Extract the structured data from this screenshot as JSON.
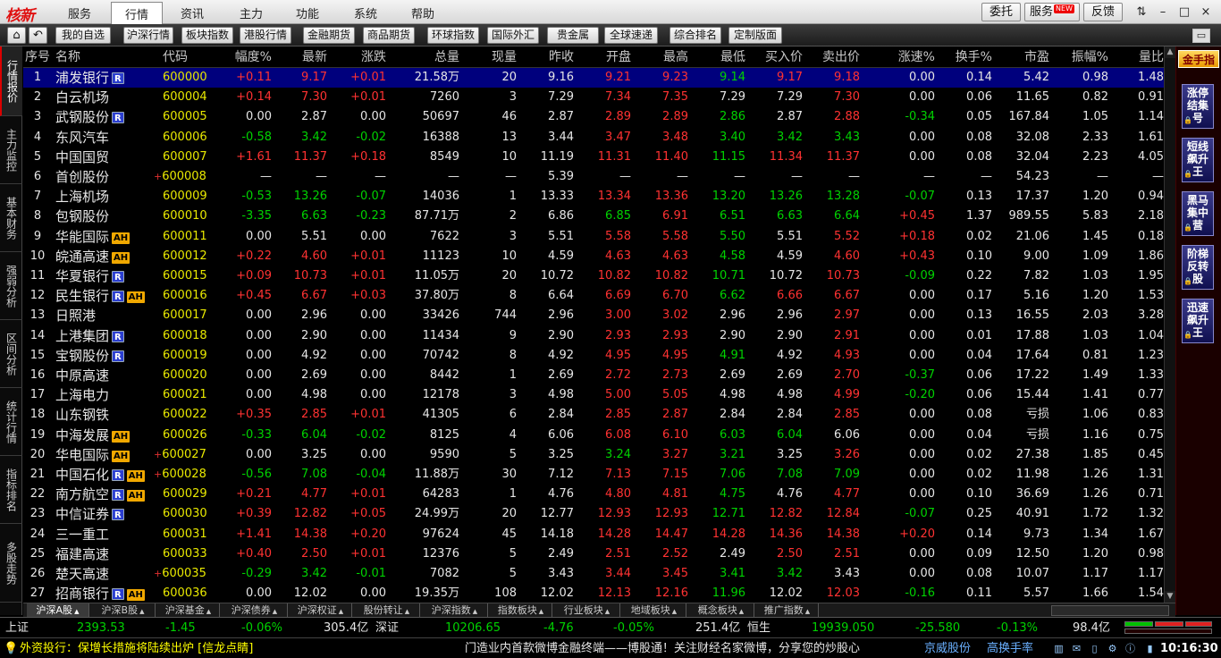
{
  "app": {
    "logo_text": "核新",
    "menu": [
      "服务",
      "行情",
      "资讯",
      "主力",
      "功能",
      "系统",
      "帮助"
    ],
    "active_menu": "行情",
    "right_buttons": {
      "weituo": "委托",
      "fuwu": "服务",
      "new_badge": "NEW",
      "fankui": "反馈"
    },
    "window_controls": [
      "⇅",
      "–",
      "□",
      "×"
    ]
  },
  "toolbar": {
    "buttons": [
      "我的自选",
      "沪深行情",
      "板块指数",
      "港股行情",
      "金融期货",
      "商品期货",
      "环球指数",
      "国际外汇",
      "贵金属",
      "全球速递",
      "综合排名",
      "定制版面"
    ]
  },
  "leftnav": [
    "行情报价",
    "主力监控",
    "基本财务",
    "强弱分析",
    "区间分析",
    "统计行情",
    "指标排名",
    "多股走势"
  ],
  "table": {
    "headers": [
      "序号",
      "名称",
      "代码",
      "幅度%",
      "最新",
      "涨跌",
      "总量",
      "现量",
      "昨收",
      "开盘",
      "最高",
      "最低",
      "买入价",
      "卖出价",
      "涨速%",
      "换手%",
      "市盈",
      "振幅%",
      "量比"
    ],
    "rows": [
      {
        "no": "1",
        "name": "浦发银行",
        "badges": [
          "R"
        ],
        "plus": false,
        "code": "600000",
        "chg_pct": "+0.11",
        "last": "9.17",
        "chg": "+0.01",
        "vol": "21.58万",
        "cur": "20",
        "prev": "9.16",
        "open": "9.21",
        "high": "9.23",
        "low": "9.14",
        "bid": "9.17",
        "ask": "9.18",
        "speed": "0.00",
        "turn": "0.14",
        "pe": "5.42",
        "amp": "0.98",
        "vr": "1.48"
      },
      {
        "no": "2",
        "name": "白云机场",
        "badges": [],
        "plus": false,
        "code": "600004",
        "chg_pct": "+0.14",
        "last": "7.30",
        "chg": "+0.01",
        "vol": "7260",
        "cur": "3",
        "prev": "7.29",
        "open": "7.34",
        "high": "7.35",
        "low": "7.29",
        "bid": "7.29",
        "ask": "7.30",
        "speed": "0.00",
        "turn": "0.06",
        "pe": "11.65",
        "amp": "0.82",
        "vr": "0.91"
      },
      {
        "no": "3",
        "name": "武钢股份",
        "badges": [
          "R"
        ],
        "plus": false,
        "code": "600005",
        "chg_pct": "0.00",
        "last": "2.87",
        "chg": "0.00",
        "vol": "50697",
        "cur": "46",
        "prev": "2.87",
        "open": "2.89",
        "high": "2.89",
        "low": "2.86",
        "bid": "2.87",
        "ask": "2.88",
        "speed": "-0.34",
        "turn": "0.05",
        "pe": "167.84",
        "amp": "1.05",
        "vr": "1.14"
      },
      {
        "no": "4",
        "name": "东风汽车",
        "badges": [],
        "plus": false,
        "code": "600006",
        "chg_pct": "-0.58",
        "last": "3.42",
        "chg": "-0.02",
        "vol": "16388",
        "cur": "13",
        "prev": "3.44",
        "open": "3.47",
        "high": "3.48",
        "low": "3.40",
        "bid": "3.42",
        "ask": "3.43",
        "speed": "0.00",
        "turn": "0.08",
        "pe": "32.08",
        "amp": "2.33",
        "vr": "1.61"
      },
      {
        "no": "5",
        "name": "中国国贸",
        "badges": [],
        "plus": false,
        "code": "600007",
        "chg_pct": "+1.61",
        "last": "11.37",
        "chg": "+0.18",
        "vol": "8549",
        "cur": "10",
        "prev": "11.19",
        "open": "11.31",
        "high": "11.40",
        "low": "11.15",
        "bid": "11.34",
        "ask": "11.37",
        "speed": "0.00",
        "turn": "0.08",
        "pe": "32.04",
        "amp": "2.23",
        "vr": "4.05"
      },
      {
        "no": "6",
        "name": "首创股份",
        "badges": [],
        "plus": true,
        "code": "600008",
        "chg_pct": "—",
        "last": "—",
        "chg": "—",
        "vol": "—",
        "cur": "—",
        "prev": "5.39",
        "open": "—",
        "high": "—",
        "low": "—",
        "bid": "—",
        "ask": "—",
        "speed": "—",
        "turn": "—",
        "pe": "54.23",
        "amp": "—",
        "vr": "—"
      },
      {
        "no": "7",
        "name": "上海机场",
        "badges": [],
        "plus": false,
        "code": "600009",
        "chg_pct": "-0.53",
        "last": "13.26",
        "chg": "-0.07",
        "vol": "14036",
        "cur": "1",
        "prev": "13.33",
        "open": "13.34",
        "high": "13.36",
        "low": "13.20",
        "bid": "13.26",
        "ask": "13.28",
        "speed": "-0.07",
        "turn": "0.13",
        "pe": "17.37",
        "amp": "1.20",
        "vr": "0.94"
      },
      {
        "no": "8",
        "name": "包钢股份",
        "badges": [],
        "plus": false,
        "code": "600010",
        "chg_pct": "-3.35",
        "last": "6.63",
        "chg": "-0.23",
        "vol": "87.71万",
        "cur": "2",
        "prev": "6.86",
        "open": "6.85",
        "high": "6.91",
        "low": "6.51",
        "bid": "6.63",
        "ask": "6.64",
        "speed": "+0.45",
        "turn": "1.37",
        "pe": "989.55",
        "amp": "5.83",
        "vr": "2.18"
      },
      {
        "no": "9",
        "name": "华能国际",
        "badges": [
          "AH"
        ],
        "plus": false,
        "code": "600011",
        "chg_pct": "0.00",
        "last": "5.51",
        "chg": "0.00",
        "vol": "7622",
        "cur": "3",
        "prev": "5.51",
        "open": "5.58",
        "high": "5.58",
        "low": "5.50",
        "bid": "5.51",
        "ask": "5.52",
        "speed": "+0.18",
        "turn": "0.02",
        "pe": "21.06",
        "amp": "1.45",
        "vr": "0.18"
      },
      {
        "no": "10",
        "name": "皖通高速",
        "badges": [
          "AH"
        ],
        "plus": false,
        "code": "600012",
        "chg_pct": "+0.22",
        "last": "4.60",
        "chg": "+0.01",
        "vol": "11123",
        "cur": "10",
        "prev": "4.59",
        "open": "4.63",
        "high": "4.63",
        "low": "4.58",
        "bid": "4.59",
        "ask": "4.60",
        "speed": "+0.43",
        "turn": "0.10",
        "pe": "9.00",
        "amp": "1.09",
        "vr": "1.86"
      },
      {
        "no": "11",
        "name": "华夏银行",
        "badges": [
          "R"
        ],
        "plus": false,
        "code": "600015",
        "chg_pct": "+0.09",
        "last": "10.73",
        "chg": "+0.01",
        "vol": "11.05万",
        "cur": "20",
        "prev": "10.72",
        "open": "10.82",
        "high": "10.82",
        "low": "10.71",
        "bid": "10.72",
        "ask": "10.73",
        "speed": "-0.09",
        "turn": "0.22",
        "pe": "7.82",
        "amp": "1.03",
        "vr": "1.95"
      },
      {
        "no": "12",
        "name": "民生银行",
        "badges": [
          "R",
          "AH"
        ],
        "plus": false,
        "code": "600016",
        "chg_pct": "+0.45",
        "last": "6.67",
        "chg": "+0.03",
        "vol": "37.80万",
        "cur": "8",
        "prev": "6.64",
        "open": "6.69",
        "high": "6.70",
        "low": "6.62",
        "bid": "6.66",
        "ask": "6.67",
        "speed": "0.00",
        "turn": "0.17",
        "pe": "5.16",
        "amp": "1.20",
        "vr": "1.53"
      },
      {
        "no": "13",
        "name": "日照港",
        "badges": [],
        "plus": false,
        "code": "600017",
        "chg_pct": "0.00",
        "last": "2.96",
        "chg": "0.00",
        "vol": "33426",
        "cur": "744",
        "prev": "2.96",
        "open": "3.00",
        "high": "3.02",
        "low": "2.96",
        "bid": "2.96",
        "ask": "2.97",
        "speed": "0.00",
        "turn": "0.13",
        "pe": "16.55",
        "amp": "2.03",
        "vr": "3.28"
      },
      {
        "no": "14",
        "name": "上港集团",
        "badges": [
          "R"
        ],
        "plus": false,
        "code": "600018",
        "chg_pct": "0.00",
        "last": "2.90",
        "chg": "0.00",
        "vol": "11434",
        "cur": "9",
        "prev": "2.90",
        "open": "2.93",
        "high": "2.93",
        "low": "2.90",
        "bid": "2.90",
        "ask": "2.91",
        "speed": "0.00",
        "turn": "0.01",
        "pe": "17.88",
        "amp": "1.03",
        "vr": "1.04"
      },
      {
        "no": "15",
        "name": "宝钢股份",
        "badges": [
          "R"
        ],
        "plus": false,
        "code": "600019",
        "chg_pct": "0.00",
        "last": "4.92",
        "chg": "0.00",
        "vol": "70742",
        "cur": "8",
        "prev": "4.92",
        "open": "4.95",
        "high": "4.95",
        "low": "4.91",
        "bid": "4.92",
        "ask": "4.93",
        "speed": "0.00",
        "turn": "0.04",
        "pe": "17.64",
        "amp": "0.81",
        "vr": "1.23"
      },
      {
        "no": "16",
        "name": "中原高速",
        "badges": [],
        "plus": false,
        "code": "600020",
        "chg_pct": "0.00",
        "last": "2.69",
        "chg": "0.00",
        "vol": "8442",
        "cur": "1",
        "prev": "2.69",
        "open": "2.72",
        "high": "2.73",
        "low": "2.69",
        "bid": "2.69",
        "ask": "2.70",
        "speed": "-0.37",
        "turn": "0.06",
        "pe": "17.22",
        "amp": "1.49",
        "vr": "1.33"
      },
      {
        "no": "17",
        "name": "上海电力",
        "badges": [],
        "plus": false,
        "code": "600021",
        "chg_pct": "0.00",
        "last": "4.98",
        "chg": "0.00",
        "vol": "12178",
        "cur": "3",
        "prev": "4.98",
        "open": "5.00",
        "high": "5.05",
        "low": "4.98",
        "bid": "4.98",
        "ask": "4.99",
        "speed": "-0.20",
        "turn": "0.06",
        "pe": "15.44",
        "amp": "1.41",
        "vr": "0.77"
      },
      {
        "no": "18",
        "name": "山东钢铁",
        "badges": [],
        "plus": false,
        "code": "600022",
        "chg_pct": "+0.35",
        "last": "2.85",
        "chg": "+0.01",
        "vol": "41305",
        "cur": "6",
        "prev": "2.84",
        "open": "2.85",
        "high": "2.87",
        "low": "2.84",
        "bid": "2.84",
        "ask": "2.85",
        "speed": "0.00",
        "turn": "0.08",
        "pe": "亏损",
        "amp": "1.06",
        "vr": "0.83"
      },
      {
        "no": "19",
        "name": "中海发展",
        "badges": [
          "AH"
        ],
        "plus": false,
        "code": "600026",
        "chg_pct": "-0.33",
        "last": "6.04",
        "chg": "-0.02",
        "vol": "8125",
        "cur": "4",
        "prev": "6.06",
        "open": "6.08",
        "high": "6.10",
        "low": "6.03",
        "bid": "6.04",
        "ask": "6.06",
        "speed": "0.00",
        "turn": "0.04",
        "pe": "亏损",
        "amp": "1.16",
        "vr": "0.75"
      },
      {
        "no": "20",
        "name": "华电国际",
        "badges": [
          "AH"
        ],
        "plus": true,
        "code": "600027",
        "chg_pct": "0.00",
        "last": "3.25",
        "chg": "0.00",
        "vol": "9590",
        "cur": "5",
        "prev": "3.25",
        "open": "3.24",
        "high": "3.27",
        "low": "3.21",
        "bid": "3.25",
        "ask": "3.26",
        "speed": "0.00",
        "turn": "0.02",
        "pe": "27.38",
        "amp": "1.85",
        "vr": "0.45"
      },
      {
        "no": "21",
        "name": "中国石化",
        "badges": [
          "R",
          "AH"
        ],
        "plus": true,
        "code": "600028",
        "chg_pct": "-0.56",
        "last": "7.08",
        "chg": "-0.04",
        "vol": "11.88万",
        "cur": "30",
        "prev": "7.12",
        "open": "7.13",
        "high": "7.15",
        "low": "7.06",
        "bid": "7.08",
        "ask": "7.09",
        "speed": "0.00",
        "turn": "0.02",
        "pe": "11.98",
        "amp": "1.26",
        "vr": "1.31"
      },
      {
        "no": "22",
        "name": "南方航空",
        "badges": [
          "R",
          "AH"
        ],
        "plus": false,
        "code": "600029",
        "chg_pct": "+0.21",
        "last": "4.77",
        "chg": "+0.01",
        "vol": "64283",
        "cur": "1",
        "prev": "4.76",
        "open": "4.80",
        "high": "4.81",
        "low": "4.75",
        "bid": "4.76",
        "ask": "4.77",
        "speed": "0.00",
        "turn": "0.10",
        "pe": "36.69",
        "amp": "1.26",
        "vr": "0.71"
      },
      {
        "no": "23",
        "name": "中信证券",
        "badges": [
          "R"
        ],
        "plus": false,
        "code": "600030",
        "chg_pct": "+0.39",
        "last": "12.82",
        "chg": "+0.05",
        "vol": "24.99万",
        "cur": "20",
        "prev": "12.77",
        "open": "12.93",
        "high": "12.93",
        "low": "12.71",
        "bid": "12.82",
        "ask": "12.84",
        "speed": "-0.07",
        "turn": "0.25",
        "pe": "40.91",
        "amp": "1.72",
        "vr": "1.32"
      },
      {
        "no": "24",
        "name": "三一重工",
        "badges": [],
        "plus": false,
        "code": "600031",
        "chg_pct": "+1.41",
        "last": "14.38",
        "chg": "+0.20",
        "vol": "97624",
        "cur": "45",
        "prev": "14.18",
        "open": "14.28",
        "high": "14.47",
        "low": "14.28",
        "bid": "14.36",
        "ask": "14.38",
        "speed": "+0.20",
        "turn": "0.14",
        "pe": "9.73",
        "amp": "1.34",
        "vr": "1.67"
      },
      {
        "no": "25",
        "name": "福建高速",
        "badges": [],
        "plus": false,
        "code": "600033",
        "chg_pct": "+0.40",
        "last": "2.50",
        "chg": "+0.01",
        "vol": "12376",
        "cur": "5",
        "prev": "2.49",
        "open": "2.51",
        "high": "2.52",
        "low": "2.49",
        "bid": "2.50",
        "ask": "2.51",
        "speed": "0.00",
        "turn": "0.09",
        "pe": "12.50",
        "amp": "1.20",
        "vr": "0.98"
      },
      {
        "no": "26",
        "name": "楚天高速",
        "badges": [],
        "plus": true,
        "code": "600035",
        "chg_pct": "-0.29",
        "last": "3.42",
        "chg": "-0.01",
        "vol": "7082",
        "cur": "5",
        "prev": "3.43",
        "open": "3.44",
        "high": "3.45",
        "low": "3.41",
        "bid": "3.42",
        "ask": "3.43",
        "speed": "0.00",
        "turn": "0.08",
        "pe": "10.07",
        "amp": "1.17",
        "vr": "1.17"
      },
      {
        "no": "27",
        "name": "招商银行",
        "badges": [
          "R",
          "AH"
        ],
        "plus": false,
        "code": "600036",
        "chg_pct": "0.00",
        "last": "12.02",
        "chg": "0.00",
        "vol": "19.35万",
        "cur": "108",
        "prev": "12.02",
        "open": "12.13",
        "high": "12.16",
        "low": "11.96",
        "bid": "12.02",
        "ask": "12.03",
        "speed": "-0.16",
        "turn": "0.11",
        "pe": "5.57",
        "amp": "1.66",
        "vr": "1.54"
      }
    ]
  },
  "rightbar": {
    "top": "金手指",
    "items": [
      "涨停结集号",
      "短线飙升王",
      "黑马集中营",
      "阶梯反转股",
      "迅速飙升王"
    ]
  },
  "bottom_tabs": [
    "沪深A股",
    "沪深B股",
    "沪深基金",
    "沪深债券",
    "沪深权证",
    "股份转让",
    "沪深指数",
    "指数板块",
    "行业板块",
    "地域板块",
    "概念板块",
    "推广指数"
  ],
  "indexbar": {
    "sh_label": "上证",
    "sh_value": "2393.53",
    "sh_chg": "-1.45",
    "sh_pct": "-0.06%",
    "sh_amt": "305.4亿",
    "sz_label": "深证",
    "sz_value": "10206.65",
    "sz_chg": "-4.76",
    "sz_pct": "-0.05%",
    "sz_amt": "251.4亿",
    "hs_label": "恒生",
    "hs_value": "19939.050",
    "hs_chg": "-25.580",
    "hs_pct": "-0.13%",
    "hs_amt": "98.4亿"
  },
  "statusbar": {
    "news": "外资投行：保增长措施将陆续出炉 [信龙点睛]",
    "ticker": "门造业内首款微博金融终端——博股通！关注财经名家微博，分享您的炒股心",
    "link1": "京威股份",
    "link2": "高换手率",
    "time": "10:16:30"
  },
  "colors": {
    "up": "#ff3232",
    "down": "#00d200",
    "code": "#e8e800",
    "selected": "#00007d"
  }
}
